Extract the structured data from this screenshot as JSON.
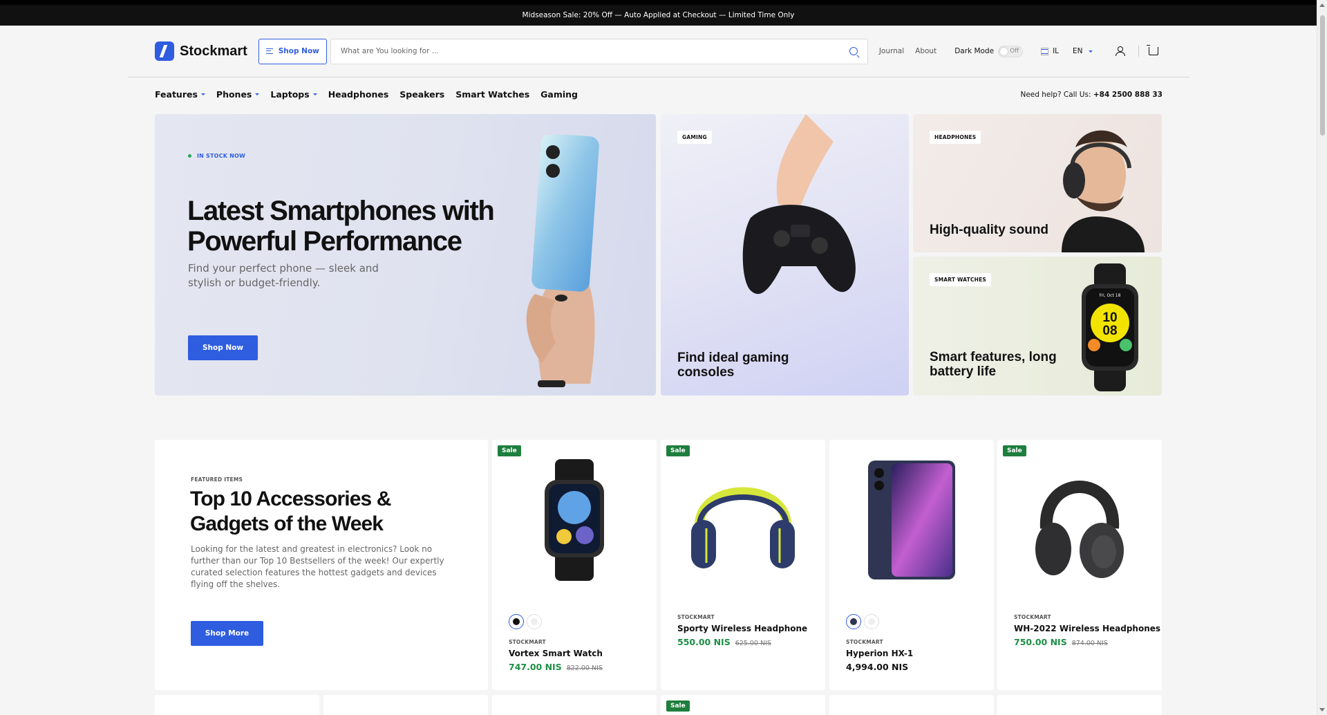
{
  "announcement": "Midseason Sale: 20% Off — Auto Applied at Checkout — Limited Time Only",
  "brand": {
    "name": "Stockmart",
    "accent": "#2f5de0"
  },
  "header": {
    "shop_now": "Shop Now",
    "search_placeholder": "What are You looking for ...",
    "links": [
      "Journal",
      "About"
    ],
    "dark_mode_label": "Dark Mode",
    "dark_mode_state": "Off",
    "country": "IL",
    "language": "EN"
  },
  "nav": {
    "items": [
      {
        "label": "Features",
        "dropdown": true
      },
      {
        "label": "Phones",
        "dropdown": true
      },
      {
        "label": "Laptops",
        "dropdown": true
      },
      {
        "label": "Headphones",
        "dropdown": false
      },
      {
        "label": "Speakers",
        "dropdown": false
      },
      {
        "label": "Smart Watches",
        "dropdown": false
      },
      {
        "label": "Gaming",
        "dropdown": false
      }
    ],
    "help_prefix": "Need help? Call Us:",
    "help_phone": "+84 2500 888 33"
  },
  "hero": {
    "badge": "IN STOCK NOW",
    "title": "Latest Smartphones with Powerful Performance",
    "subtitle": "Find your perfect phone — sleek and stylish or budget-friendly.",
    "button": "Shop Now"
  },
  "promos": {
    "gaming": {
      "tag": "GAMING",
      "title": "Find ideal gaming consoles"
    },
    "headphones": {
      "tag": "HEADPHONES",
      "title": "High-quality sound"
    },
    "watches": {
      "tag": "SMART WATCHES",
      "title": "Smart features, long battery life"
    }
  },
  "featured": {
    "eyebrow": "FEATURED ITEMS",
    "title": "Top 10 Accessories & Gadgets of the Week",
    "description": "Looking for the latest and greatest in electronics? Look no further than our Top 10 Bestsellers of the week! Our expertly curated selection features the hottest gadgets and devices flying off the shelves.",
    "button": "Shop More"
  },
  "watch_face": {
    "date": "Fri, Oct 18",
    "hour": "10",
    "minute": "08"
  },
  "products": [
    {
      "brand": "STOCKMART",
      "name": "Vortex Smart Watch",
      "price": "747.00 NIS",
      "old_price": "822.00 NIS",
      "sale": "Sale"
    },
    {
      "brand": "STOCKMART",
      "name": "Sporty Wireless Headphone",
      "price": "550.00 NIS",
      "old_price": "625.00 NIS",
      "sale": "Sale"
    },
    {
      "brand": "STOCKMART",
      "name": "Hyperion HX-1",
      "price": "4,994.00 NIS",
      "old_price": "",
      "sale": ""
    },
    {
      "brand": "STOCKMART",
      "name": "WH-2022 Wireless Headphones",
      "price": "750.00 NIS",
      "old_price": "874.00 NIS",
      "sale": "Sale"
    }
  ],
  "row2_badge": "Sale",
  "colors": {
    "sale": "#1e7e3e",
    "price": "#1e8e46",
    "topbar": "#111111"
  }
}
